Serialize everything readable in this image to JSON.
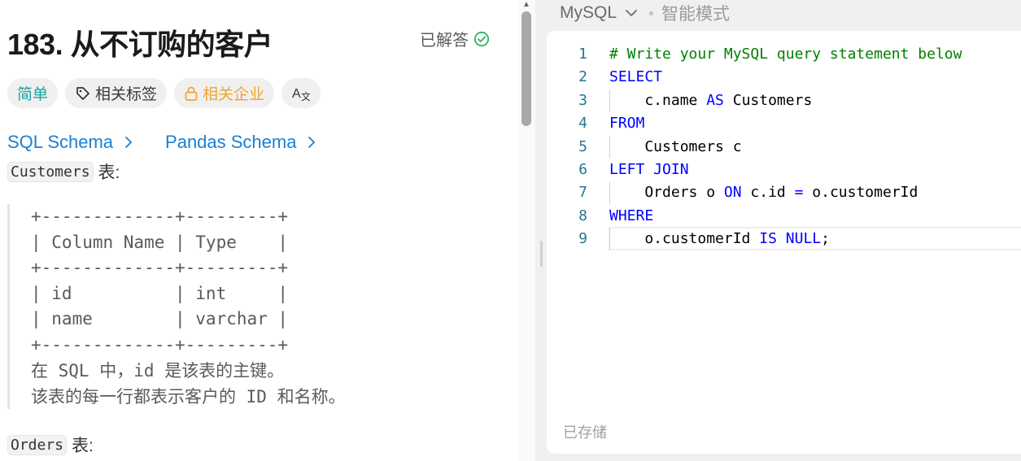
{
  "problem": {
    "title": "183. 从不订购的客户",
    "status": "已解答",
    "tags": {
      "difficulty": "简单",
      "topics": "相关标签",
      "companies": "相关企业",
      "translate": "A文"
    },
    "breadcrumbs": [
      "SQL Schema",
      "Pandas Schema"
    ],
    "customers_table": {
      "name": "Customers",
      "suffix": "表:",
      "schema": "+-------------+---------+\n| Column Name | Type    |\n+-------------+---------+\n| id          | int     |\n| name        | varchar |\n+-------------+---------+",
      "desc1": "在 SQL 中，id 是该表的主键。",
      "desc2": "该表的每一行都表示客户的 ID 和名称。"
    },
    "orders_table": {
      "name": "Orders",
      "suffix": "表:"
    }
  },
  "editor": {
    "language": "MySQL",
    "mode": "智能模式",
    "status": "已存储",
    "lines": [
      {
        "n": "1",
        "indent": false,
        "tokens": [
          {
            "t": "# Write your MySQL query statement below",
            "c": "cm"
          }
        ]
      },
      {
        "n": "2",
        "indent": false,
        "tokens": [
          {
            "t": "SELECT",
            "c": "kw"
          }
        ]
      },
      {
        "n": "3",
        "indent": true,
        "tokens": [
          {
            "t": "    c.name ",
            "c": ""
          },
          {
            "t": "AS",
            "c": "kw"
          },
          {
            "t": " Customers",
            "c": ""
          }
        ]
      },
      {
        "n": "4",
        "indent": false,
        "tokens": [
          {
            "t": "FROM",
            "c": "kw"
          }
        ]
      },
      {
        "n": "5",
        "indent": true,
        "tokens": [
          {
            "t": "    Customers c",
            "c": ""
          }
        ]
      },
      {
        "n": "6",
        "indent": false,
        "tokens": [
          {
            "t": "LEFT JOIN",
            "c": "kw"
          }
        ]
      },
      {
        "n": "7",
        "indent": true,
        "tokens": [
          {
            "t": "    Orders o ",
            "c": ""
          },
          {
            "t": "ON",
            "c": "kw"
          },
          {
            "t": " c.id ",
            "c": ""
          },
          {
            "t": "=",
            "c": "kw"
          },
          {
            "t": " o.customerId",
            "c": ""
          }
        ]
      },
      {
        "n": "8",
        "indent": false,
        "tokens": [
          {
            "t": "WHERE",
            "c": "kw"
          }
        ]
      },
      {
        "n": "9",
        "indent": true,
        "tokens": [
          {
            "t": "    o.customerId ",
            "c": ""
          },
          {
            "t": "IS",
            "c": "kw"
          },
          {
            "t": " ",
            "c": ""
          },
          {
            "t": "NULL",
            "c": "kw"
          },
          {
            "t": ";",
            "c": ""
          }
        ]
      }
    ]
  },
  "colors": {
    "easy": "#15a4a4",
    "company": "#f0a431",
    "link": "#1a7fd3",
    "solved": "#2db55d",
    "keyword": "#0000ff",
    "comment": "#008000",
    "line_number": "#237893"
  }
}
